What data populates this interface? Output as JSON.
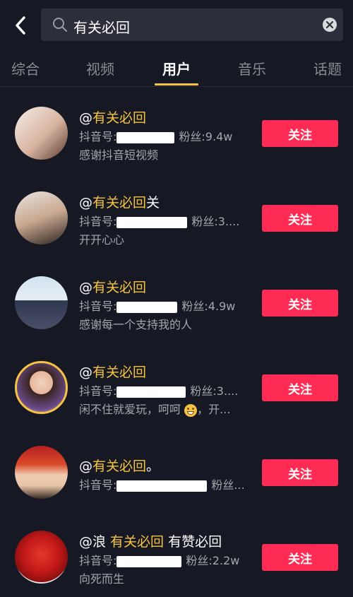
{
  "search": {
    "query": "有关必回"
  },
  "tabs": [
    {
      "label": "综合"
    },
    {
      "label": "视频"
    },
    {
      "label": "用户"
    },
    {
      "label": "音乐"
    },
    {
      "label": "话题"
    }
  ],
  "colors": {
    "accent": "#f6c342",
    "follow": "#fe2c55",
    "background": "#161823"
  },
  "users": [
    {
      "name_prefix": "@",
      "name_highlight": "有关必回",
      "name_suffix": "",
      "id_label": "抖音号:",
      "fans": "粉丝:9.4w",
      "desc": "感谢抖音短视频",
      "follow": "关注"
    },
    {
      "name_prefix": "@",
      "name_highlight": "有关必回",
      "name_suffix": "关",
      "id_label": "抖音号:",
      "fans": "粉丝:3....",
      "desc": "开开心心",
      "follow": "关注"
    },
    {
      "name_prefix": "@",
      "name_highlight": "有关必回",
      "name_suffix": "",
      "id_label": "抖音号:",
      "fans": "粉丝:4.9w",
      "desc": "感谢每一个支持我的人",
      "follow": "关注"
    },
    {
      "name_prefix": "@",
      "name_highlight": "有关必回",
      "name_suffix": "",
      "id_label": "抖音号:",
      "fans": "粉丝:3....",
      "desc_a": "闲不住就爱玩，呵呵",
      "desc_b": "，开...",
      "follow": "关注"
    },
    {
      "name_prefix": "@",
      "name_highlight": "有关必回",
      "name_suffix": "。",
      "id_label": "抖音号:",
      "fans": "粉丝...",
      "desc": "",
      "follow": "关注"
    },
    {
      "name_prefix": "@浪 ",
      "name_highlight": "有关必回",
      "name_suffix": " 有赞必回",
      "id_label": "抖音号:",
      "fans": "粉丝:2.2w",
      "desc": "向死而生",
      "follow": "关注"
    }
  ]
}
